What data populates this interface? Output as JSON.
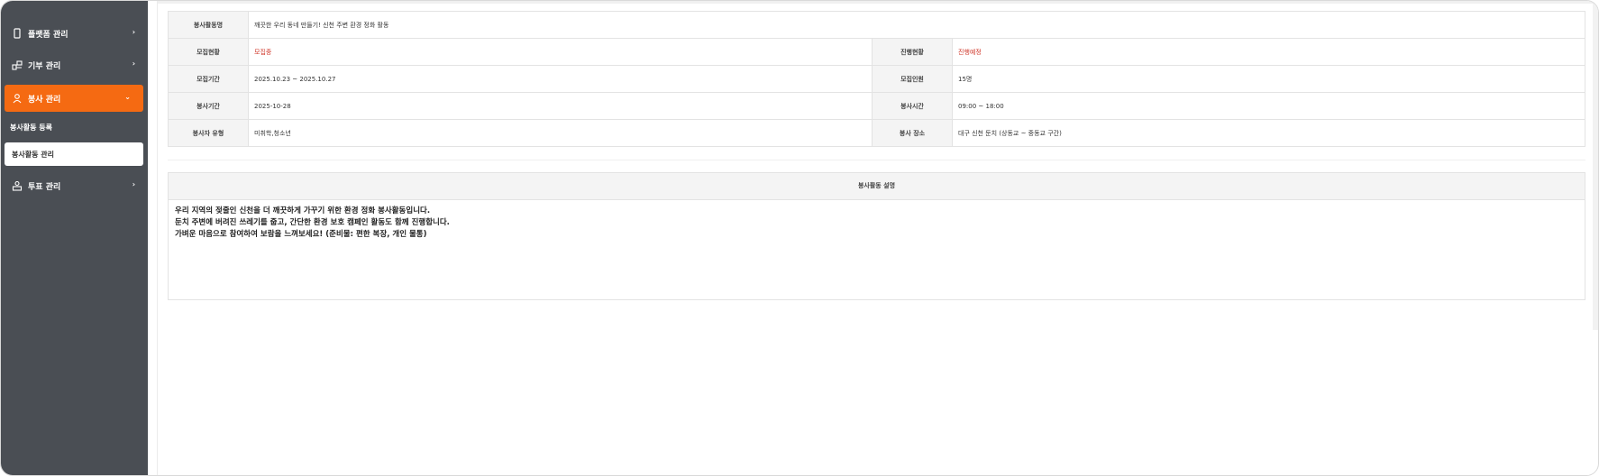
{
  "sidebar": {
    "menu": [
      {
        "label": "플랫폼 관리",
        "icon": "phone-icon",
        "arrow": "›"
      },
      {
        "label": "기부 관리",
        "icon": "donation-icon",
        "arrow": "›"
      },
      {
        "label": "봉사 관리",
        "icon": "volunteer-icon",
        "arrow": "⌄"
      },
      {
        "label": "투표 관리",
        "icon": "vote-icon",
        "arrow": "›"
      }
    ],
    "sub_items": [
      {
        "label": "봉사활동 등록"
      },
      {
        "label": "봉사활동 관리"
      }
    ],
    "accent_color": "#f56a12",
    "background_color": "#4a4e54"
  },
  "detail": {
    "name_label": "봉사활동명",
    "name_value": "깨끗한 우리 동네 만들기! 신천 주변 환경 정화 활동",
    "recruit_status_label": "모집현황",
    "recruit_status_value": "모집중",
    "progress_status_label": "진행현황",
    "progress_status_value": "진행예정",
    "recruit_period_label": "모집기간",
    "recruit_period_value": "2025.10.23 ~ 2025.10.27",
    "recruit_count_label": "모집인원",
    "recruit_count_value": "15명",
    "volunteer_date_label": "봉사기간",
    "volunteer_date_value": "2025-10-28",
    "volunteer_time_label": "봉사시간",
    "volunteer_time_value": "09:00 ~ 18:00",
    "volunteer_type_label": "봉사자 유형",
    "volunteer_type_value": "미취학,청소년",
    "volunteer_place_label": "봉사 장소",
    "volunteer_place_value": "대구 신천 둔치 (상동교 ~ 중동교 구간)"
  },
  "description": {
    "header": "봉사활동 설명",
    "lines": [
      "우리 지역의 젖줄인 신천을 더 깨끗하게 가꾸기 위한 환경 정화 봉사활동입니다.",
      "둔치 주변에 버려진 쓰레기를 줍고, 간단한 환경 보호 캠페인 활동도 함께 진행합니다.",
      "가벼운 마음으로 참여하여 보람을 느껴보세요! (준비물: 편한 복장, 개인 물통)"
    ]
  },
  "status_color": "#d0382b"
}
